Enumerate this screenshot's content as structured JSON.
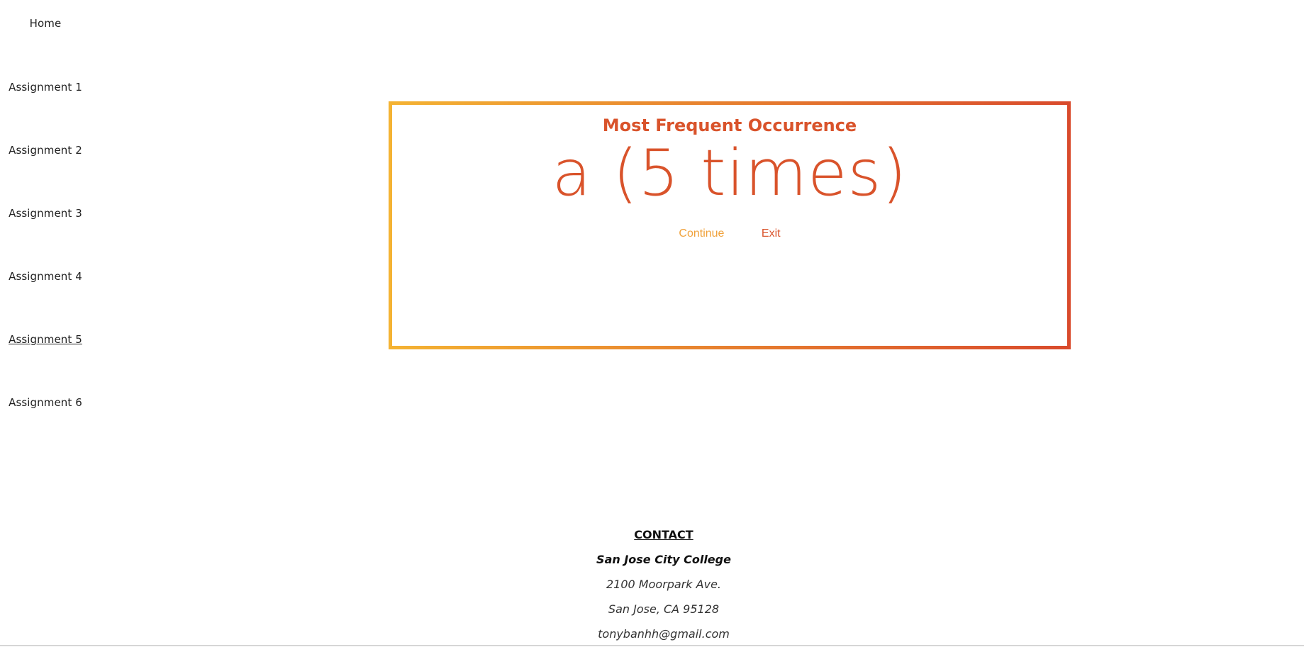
{
  "nav": {
    "items": [
      {
        "label": "Home"
      },
      {
        "label": "Assignment 1"
      },
      {
        "label": "Assignment 2"
      },
      {
        "label": "Assignment 3"
      },
      {
        "label": "Assignment 4"
      },
      {
        "label": "Assignment 5"
      },
      {
        "label": "Assignment 6"
      }
    ],
    "active": "Assignment 5"
  },
  "card": {
    "title": "Most Frequent Occurrence",
    "result": "a (5 times)",
    "continue_label": "Continue",
    "exit_label": "Exit"
  },
  "footer": {
    "heading": "CONTACT",
    "college": "San Jose City College",
    "address_line1": "2100 Moorpark Ave.",
    "address_line2": "San Jose, CA 95128",
    "email": "tonybanhh@gmail.com"
  },
  "colors": {
    "accent_red": "#d9532b",
    "accent_orange": "#f0a13a",
    "gradient_start": "#f4b333",
    "gradient_end": "#d94a2c"
  }
}
